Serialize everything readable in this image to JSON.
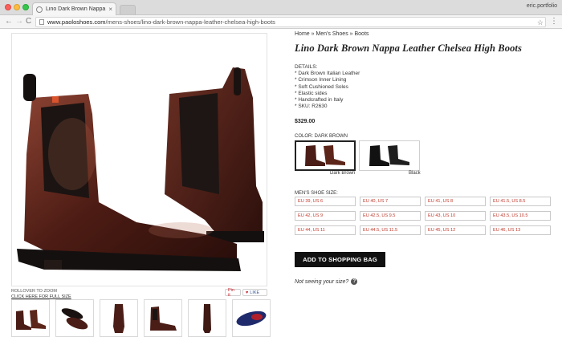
{
  "browser": {
    "tab_title": "Lino Dark Brown Nappa Leathe",
    "tab_close": "×",
    "profile": "eric.portfolio",
    "url_host": "www.paoloshoes.com",
    "url_path": "/mens-shoes/lino-dark-brown-nappa-leather-chelsea-high-boots",
    "back_icon": "←",
    "forward_icon": "→",
    "reload_icon": "C",
    "star_icon": "☆",
    "menu_icon": "⋮"
  },
  "breadcrumb": "Home » Men's Shoes » Boots",
  "product": {
    "title": "Lino Dark Brown Nappa Leather Chelsea High Boots",
    "details_heading": "DETAILS:",
    "details": [
      "* Dark Brown Italian Leather",
      "* Crimson Inner Lining",
      "* Soft Cushioned Soles",
      "* Elastic sides",
      "* Handcrafted in Italy",
      "* SKU: R2630"
    ],
    "price": "$329.00",
    "color_label": "COLOR: DARK BROWN",
    "colors": [
      "Dark Brown",
      "Black"
    ],
    "size_label": "MEN'S SHOE SIZE:",
    "sizes": [
      "EU 39, US 6",
      "EU 40, US 7",
      "EU 41, US 8",
      "EU 41.5, US 8.5",
      "EU 42, US 9",
      "EU 42.5, US 9.5",
      "EU 43, US 10",
      "EU 43.5, US 10.5",
      "EU 44, US 11",
      "EU 44.5, US 11.5",
      "EU 45, US 12",
      "EU 46, US 13"
    ],
    "add_button": "ADD TO SHOPPING BAG",
    "size_help": "Not seeing your size?",
    "help_icon": "?"
  },
  "gallery": {
    "rollover": "ROLLOVER TO ZOOM",
    "full_size": "CLICK HERE FOR FULL SIZE",
    "pin_label": "Pin it",
    "like_label": "LIKE"
  },
  "colors": {
    "leather": "#4a1d16",
    "leather_light": "#7b3a2b",
    "sole": "#151010",
    "size_text": "#c0392b"
  }
}
